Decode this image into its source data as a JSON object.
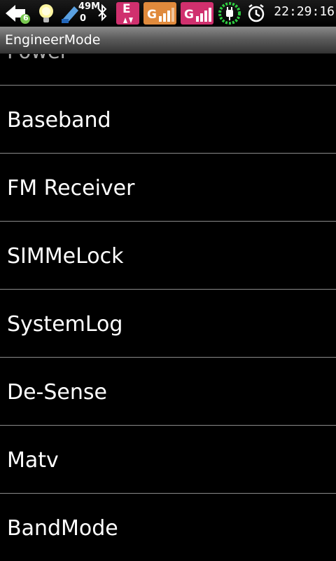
{
  "status_bar": {
    "usb_count": "6",
    "memory_label": "49M",
    "memory_sub": "0",
    "network_type_1": "E",
    "sim1_label": "G",
    "sim2_label": "G",
    "time": "22:29:16"
  },
  "title_bar": {
    "title": "EngineerMode"
  },
  "list": {
    "partial_item": "Power",
    "items": [
      {
        "label": "Baseband"
      },
      {
        "label": "FM Receiver"
      },
      {
        "label": "SIMMeLock"
      },
      {
        "label": "SystemLog"
      },
      {
        "label": "De-Sense"
      },
      {
        "label": "Matv"
      },
      {
        "label": "BandMode"
      }
    ]
  },
  "colors": {
    "background": "#000000",
    "text": "#ffffff",
    "divider": "#8a8a8a",
    "network_badge": "#d0306e",
    "sim1_badge": "#e08a3c",
    "sim2_badge": "#d0306e",
    "battery_ring": "#2ecc40"
  }
}
